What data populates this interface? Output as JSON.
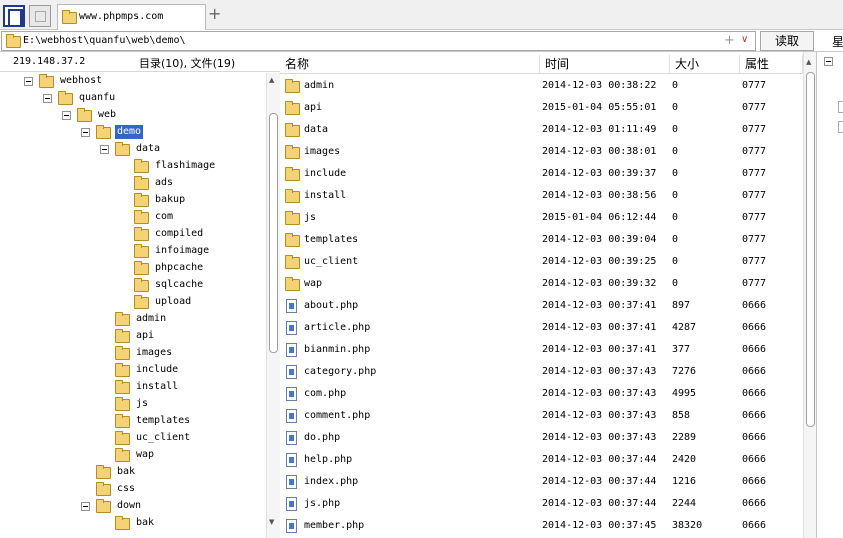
{
  "tab": {
    "title": "www.phpmps.com",
    "new_tab_glyph": "+"
  },
  "address": {
    "path": "E:\\webhost\\quanfu\\web\\demo\\",
    "plus_glyph": "+",
    "dropdown_glyph": "∨",
    "read_label": "读取",
    "right_label": "星"
  },
  "left_header": {
    "ip": "219.148.37.2",
    "counts": "目录(10), 文件(19)"
  },
  "tree": [
    {
      "label": "webhost",
      "depth": 0,
      "toggle": true
    },
    {
      "label": "quanfu",
      "depth": 1,
      "toggle": true
    },
    {
      "label": "web",
      "depth": 2,
      "toggle": true
    },
    {
      "label": "demo",
      "depth": 3,
      "toggle": true,
      "selected": true
    },
    {
      "label": "data",
      "depth": 4,
      "toggle": true
    },
    {
      "label": "flashimage",
      "depth": 5
    },
    {
      "label": "ads",
      "depth": 5
    },
    {
      "label": "bakup",
      "depth": 5
    },
    {
      "label": "com",
      "depth": 5
    },
    {
      "label": "compiled",
      "depth": 5
    },
    {
      "label": "infoimage",
      "depth": 5
    },
    {
      "label": "phpcache",
      "depth": 5
    },
    {
      "label": "sqlcache",
      "depth": 5
    },
    {
      "label": "upload",
      "depth": 5
    },
    {
      "label": "admin",
      "depth": 4
    },
    {
      "label": "api",
      "depth": 4
    },
    {
      "label": "images",
      "depth": 4
    },
    {
      "label": "include",
      "depth": 4
    },
    {
      "label": "install",
      "depth": 4
    },
    {
      "label": "js",
      "depth": 4
    },
    {
      "label": "templates",
      "depth": 4
    },
    {
      "label": "uc_client",
      "depth": 4
    },
    {
      "label": "wap",
      "depth": 4
    },
    {
      "label": "bak",
      "depth": 3
    },
    {
      "label": "css",
      "depth": 3
    },
    {
      "label": "down",
      "depth": 3,
      "toggle": true
    },
    {
      "label": "bak",
      "depth": 4
    }
  ],
  "list_header": {
    "name": "名称",
    "time": "时间",
    "size": "大小",
    "attr": "属性"
  },
  "files": [
    {
      "name": "admin",
      "time": "2014-12-03 00:38:22",
      "size": "0",
      "attr": "0777",
      "type": "folder"
    },
    {
      "name": "api",
      "time": "2015-01-04 05:55:01",
      "size": "0",
      "attr": "0777",
      "type": "folder"
    },
    {
      "name": "data",
      "time": "2014-12-03 01:11:49",
      "size": "0",
      "attr": "0777",
      "type": "folder"
    },
    {
      "name": "images",
      "time": "2014-12-03 00:38:01",
      "size": "0",
      "attr": "0777",
      "type": "folder"
    },
    {
      "name": "include",
      "time": "2014-12-03 00:39:37",
      "size": "0",
      "attr": "0777",
      "type": "folder"
    },
    {
      "name": "install",
      "time": "2014-12-03 00:38:56",
      "size": "0",
      "attr": "0777",
      "type": "folder"
    },
    {
      "name": "js",
      "time": "2015-01-04 06:12:44",
      "size": "0",
      "attr": "0777",
      "type": "folder"
    },
    {
      "name": "templates",
      "time": "2014-12-03 00:39:04",
      "size": "0",
      "attr": "0777",
      "type": "folder"
    },
    {
      "name": "uc_client",
      "time": "2014-12-03 00:39:25",
      "size": "0",
      "attr": "0777",
      "type": "folder"
    },
    {
      "name": "wap",
      "time": "2014-12-03 00:39:32",
      "size": "0",
      "attr": "0777",
      "type": "folder"
    },
    {
      "name": "about.php",
      "time": "2014-12-03 00:37:41",
      "size": "897",
      "attr": "0666",
      "type": "file"
    },
    {
      "name": "article.php",
      "time": "2014-12-03 00:37:41",
      "size": "4287",
      "attr": "0666",
      "type": "file"
    },
    {
      "name": "bianmin.php",
      "time": "2014-12-03 00:37:41",
      "size": "377",
      "attr": "0666",
      "type": "file"
    },
    {
      "name": "category.php",
      "time": "2014-12-03 00:37:43",
      "size": "7276",
      "attr": "0666",
      "type": "file"
    },
    {
      "name": "com.php",
      "time": "2014-12-03 00:37:43",
      "size": "4995",
      "attr": "0666",
      "type": "file"
    },
    {
      "name": "comment.php",
      "time": "2014-12-03 00:37:43",
      "size": "858",
      "attr": "0666",
      "type": "file"
    },
    {
      "name": "do.php",
      "time": "2014-12-03 00:37:43",
      "size": "2289",
      "attr": "0666",
      "type": "file"
    },
    {
      "name": "help.php",
      "time": "2014-12-03 00:37:44",
      "size": "2420",
      "attr": "0666",
      "type": "file"
    },
    {
      "name": "index.php",
      "time": "2014-12-03 00:37:44",
      "size": "1216",
      "attr": "0666",
      "type": "file"
    },
    {
      "name": "js.php",
      "time": "2014-12-03 00:37:44",
      "size": "2244",
      "attr": "0666",
      "type": "file"
    },
    {
      "name": "member.php",
      "time": "2014-12-03 00:37:45",
      "size": "38320",
      "attr": "0666",
      "type": "file"
    }
  ],
  "scroll": {
    "up_glyph": "▲",
    "down_glyph": "▼"
  },
  "colors": {
    "selected_bg": "#3366cc",
    "folder_fill": "#f3d375",
    "addr_dropdown": "#c03030"
  }
}
